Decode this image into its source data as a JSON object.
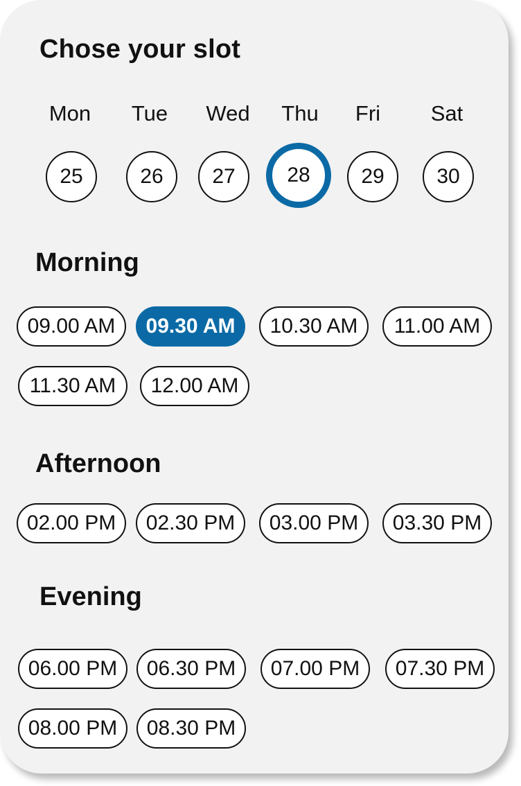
{
  "title": "Chose your slot",
  "days": [
    {
      "label": "Mon",
      "date": "25"
    },
    {
      "label": "Tue",
      "date": "26"
    },
    {
      "label": "Wed",
      "date": "27"
    },
    {
      "label": "Thu",
      "date": "28",
      "selected": true
    },
    {
      "label": "Fri",
      "date": "29"
    },
    {
      "label": "Sat",
      "date": "30"
    }
  ],
  "sections": {
    "morning": {
      "title": "Morning",
      "slots": [
        "09.00 AM",
        "09.30 AM",
        "10.30 AM",
        "11.00 AM",
        "11.30 AM",
        "12.00 AM"
      ],
      "selected": "09.30 AM"
    },
    "afternoon": {
      "title": "Afternoon",
      "slots": [
        "02.00 PM",
        "02.30 PM",
        "03.00 PM",
        "03.30 PM"
      ]
    },
    "evening": {
      "title": "Evening",
      "slots": [
        "06.00 PM",
        "06.30 PM",
        "07.00 PM",
        "07.30 PM",
        "08.00 PM",
        "08.30 PM"
      ]
    }
  },
  "colors": {
    "accent": "#0b6aa5",
    "card": "#f2f2f2"
  }
}
